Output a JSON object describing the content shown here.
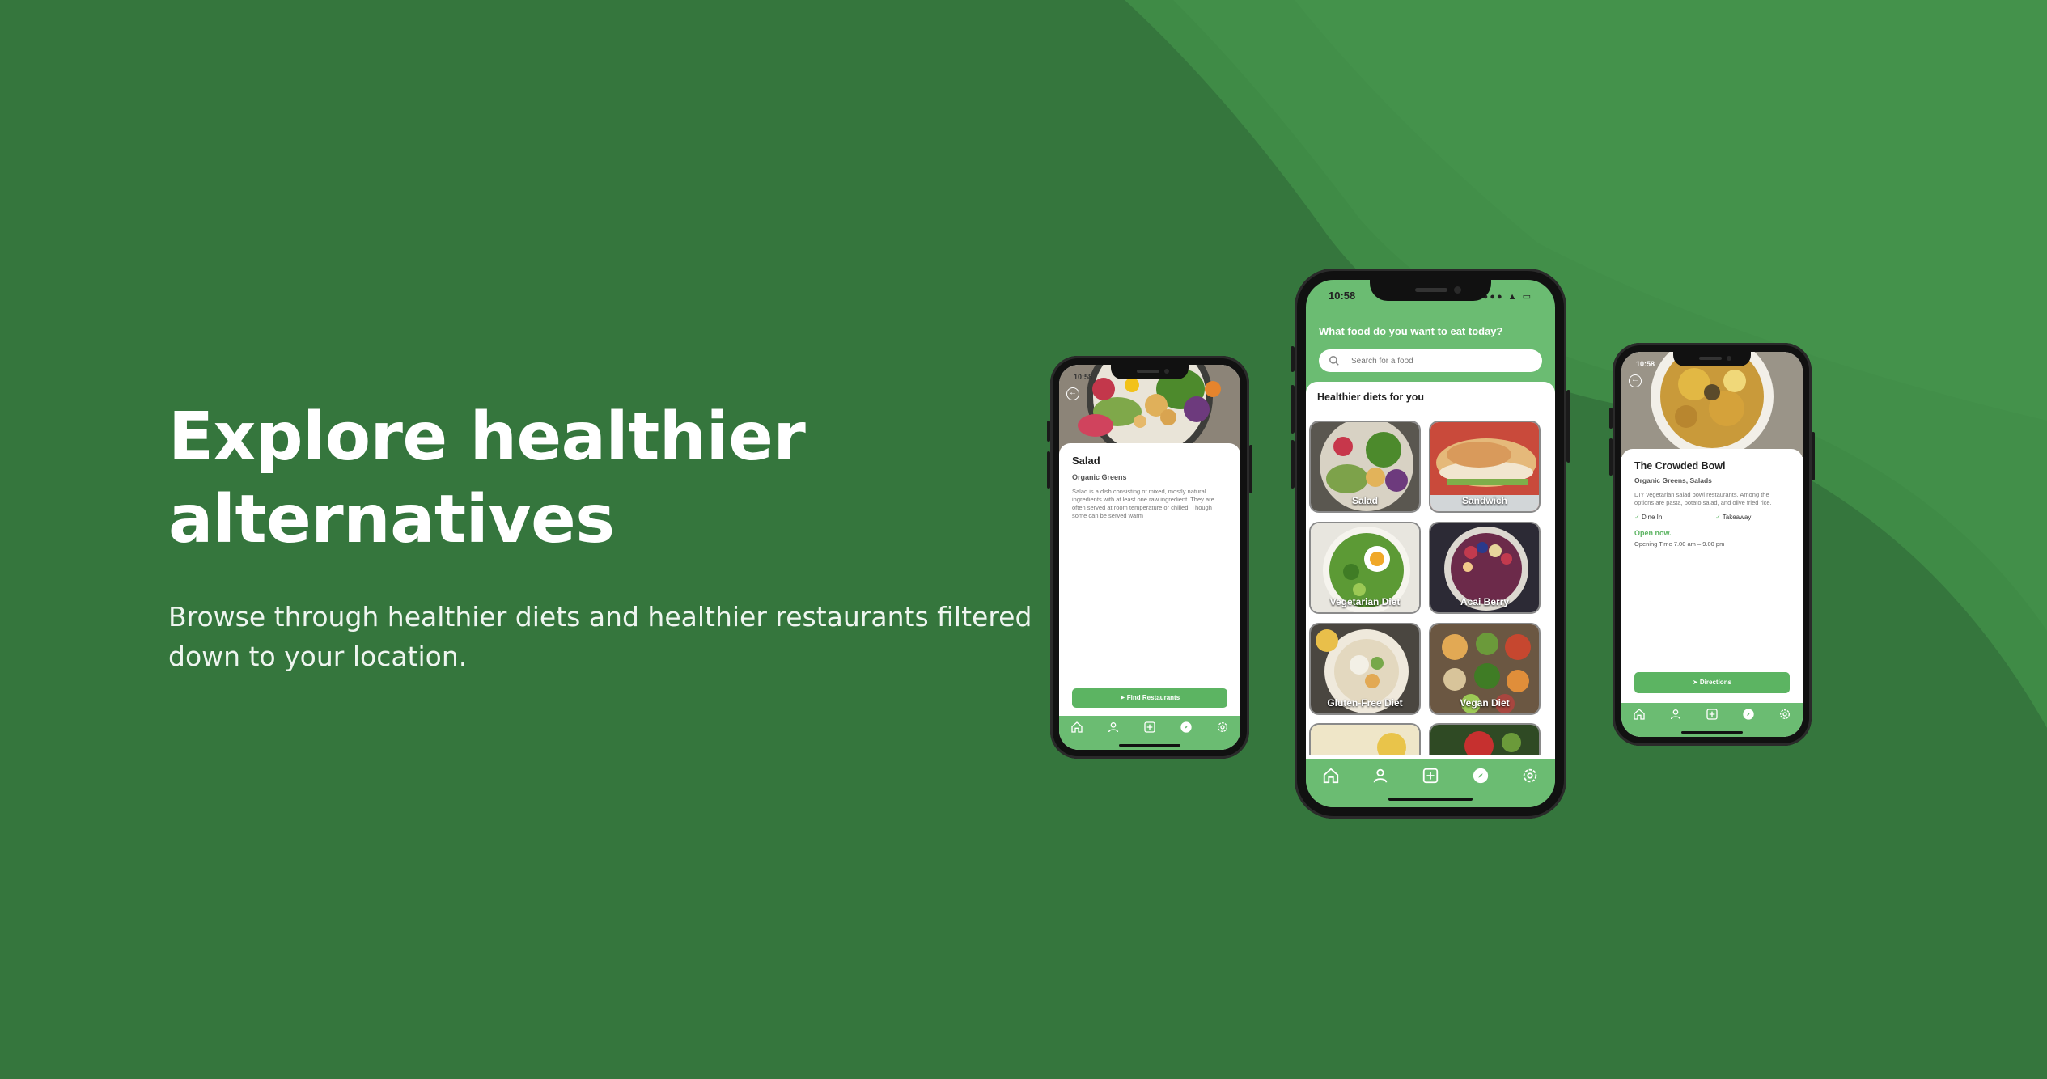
{
  "hero": {
    "title_line1": "Explore healthier",
    "title_line2": "alternatives",
    "subtitle_line1": "Browse through healthier diets and healthier restaurants filtered",
    "subtitle_line2": "down to your location."
  },
  "colors": {
    "background": "#35763d",
    "wave": "#4a9a50",
    "app_green": "#6bbc72",
    "button_green": "#5cb462"
  },
  "phone_left": {
    "status_time": "10:58",
    "title": "Salad",
    "subtitle": "Organic Greens",
    "description": "Salad is a dish consisting of mixed, mostly natural ingredients with at least one raw ingredient. They are often served at room temperature or chilled. Though some can be served warm",
    "button_label": "Find Restaurants"
  },
  "phone_center": {
    "status_time": "10:58",
    "header": "What food do you want to eat today?",
    "search_placeholder": "Search for a food",
    "section_title": "Healthier diets for you",
    "cards": [
      {
        "label": "Salad"
      },
      {
        "label": "Sandwich"
      },
      {
        "label": "Vegetarian Diet"
      },
      {
        "label": "Acai Berry"
      },
      {
        "label": "Gluten-Free Diet"
      },
      {
        "label": "Vegan Diet"
      }
    ]
  },
  "phone_right": {
    "status_time": "10:58",
    "title": "The Crowded Bowl",
    "subtitle": "Organic Greens, Salads",
    "description": "DIY vegetarian salad bowl restaurants. Among the options are pasta, potato salad, and olive fried rice.",
    "option_dine_in": "Dine In",
    "option_takeaway": "Takeaway",
    "open_status": "Open now.",
    "opening_time": "Opening Time 7.00 am – 9.00 pm",
    "button_label": "Directions"
  },
  "tab_icons": [
    "home-icon",
    "profile-icon",
    "add-icon",
    "compass-icon",
    "settings-icon"
  ]
}
